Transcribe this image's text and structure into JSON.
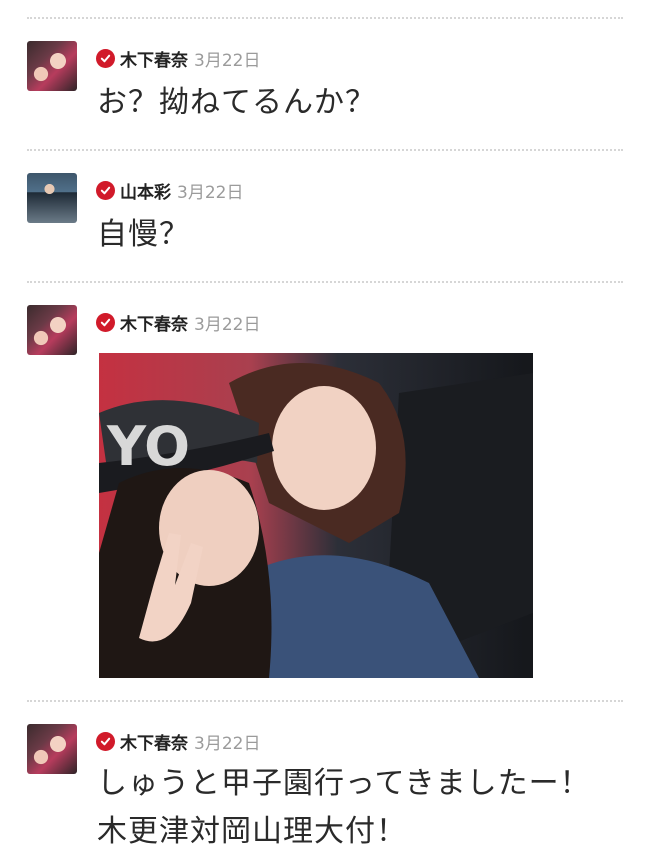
{
  "posts": [
    {
      "author": "木下春奈",
      "date": "3月22日",
      "avatar_icon": "avatar-kinoshita",
      "verified_icon": "verified-check-icon",
      "text": "お？拗ねてるんか？"
    },
    {
      "author": "山本彩",
      "date": "3月22日",
      "avatar_icon": "avatar-yamamoto",
      "verified_icon": "verified-check-icon",
      "text": "自慢？"
    },
    {
      "author": "木下春奈",
      "date": "3月22日",
      "avatar_icon": "avatar-kinoshita",
      "verified_icon": "verified-check-icon",
      "photo": "selfie-photo"
    },
    {
      "author": "木下春奈",
      "date": "3月22日",
      "avatar_icon": "avatar-kinoshita",
      "verified_icon": "verified-check-icon",
      "text_lines": [
        "しゅうと甲子園行ってきましたー！",
        "木更津対岡山理大付！"
      ]
    }
  ],
  "colors": {
    "verified": "#d11a2a",
    "date": "#9b9b9b",
    "divider": "#d6d6d6"
  }
}
